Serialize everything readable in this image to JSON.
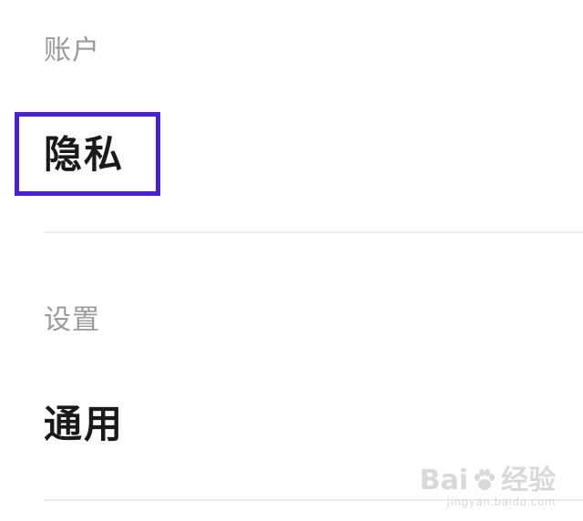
{
  "sections": [
    {
      "header": "账户",
      "item": "隐私"
    },
    {
      "header": "设置",
      "item": "通用"
    }
  ],
  "highlight_color": "#4a1fdc",
  "watermark": {
    "brand": "Bai",
    "brand_suffix": "经验",
    "url": "jingyan.baidu.com",
    "icon": "paw-icon"
  }
}
